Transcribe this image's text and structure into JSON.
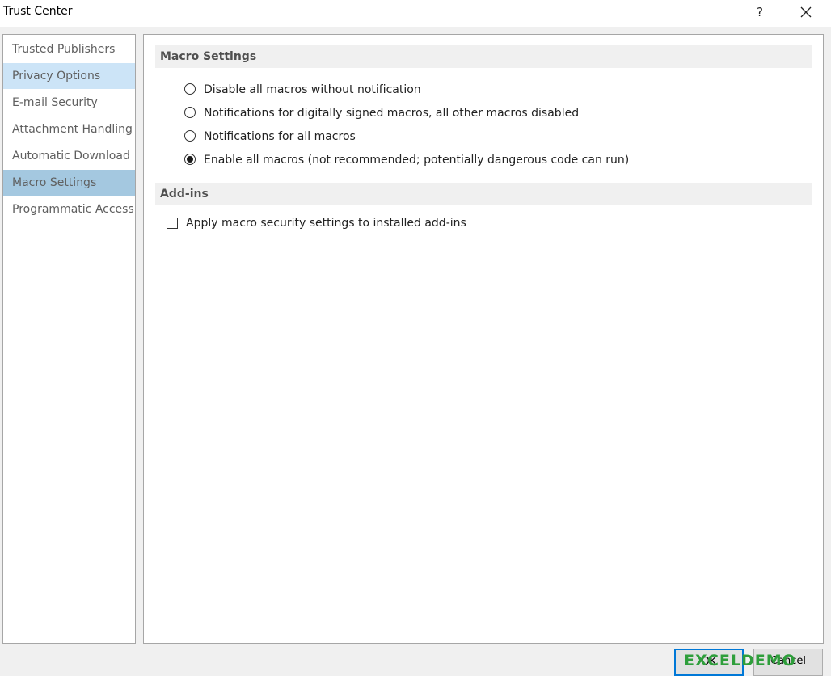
{
  "window": {
    "title": "Trust Center",
    "help_label": "?",
    "close_icon": "close-icon"
  },
  "sidebar": {
    "items": [
      {
        "label": "Trusted Publishers",
        "state": "normal"
      },
      {
        "label": "Privacy Options",
        "state": "hover"
      },
      {
        "label": "E-mail Security",
        "state": "normal"
      },
      {
        "label": "Attachment Handling",
        "state": "normal"
      },
      {
        "label": "Automatic Download",
        "state": "normal"
      },
      {
        "label": "Macro Settings",
        "state": "selected"
      },
      {
        "label": "Programmatic Access",
        "state": "normal"
      }
    ]
  },
  "macro_settings": {
    "heading": "Macro Settings",
    "options": [
      {
        "label": "Disable all macros without notification",
        "selected": false
      },
      {
        "label": "Notifications for digitally signed macros, all other macros disabled",
        "selected": false
      },
      {
        "label": "Notifications for all macros",
        "selected": false
      },
      {
        "label": "Enable all macros (not recommended; potentially dangerous code can run)",
        "selected": true
      }
    ]
  },
  "addins": {
    "heading": "Add-ins",
    "checkbox_label": "Apply macro security settings to installed add-ins",
    "checked": false
  },
  "buttons": {
    "ok_label": "OK",
    "cancel_label": "Cancel"
  },
  "watermark": "EXCELDEMO",
  "colors": {
    "selected_nav": "#a4c8e0",
    "hover_nav": "#cce4f7",
    "default_button_border": "#0078d7"
  }
}
